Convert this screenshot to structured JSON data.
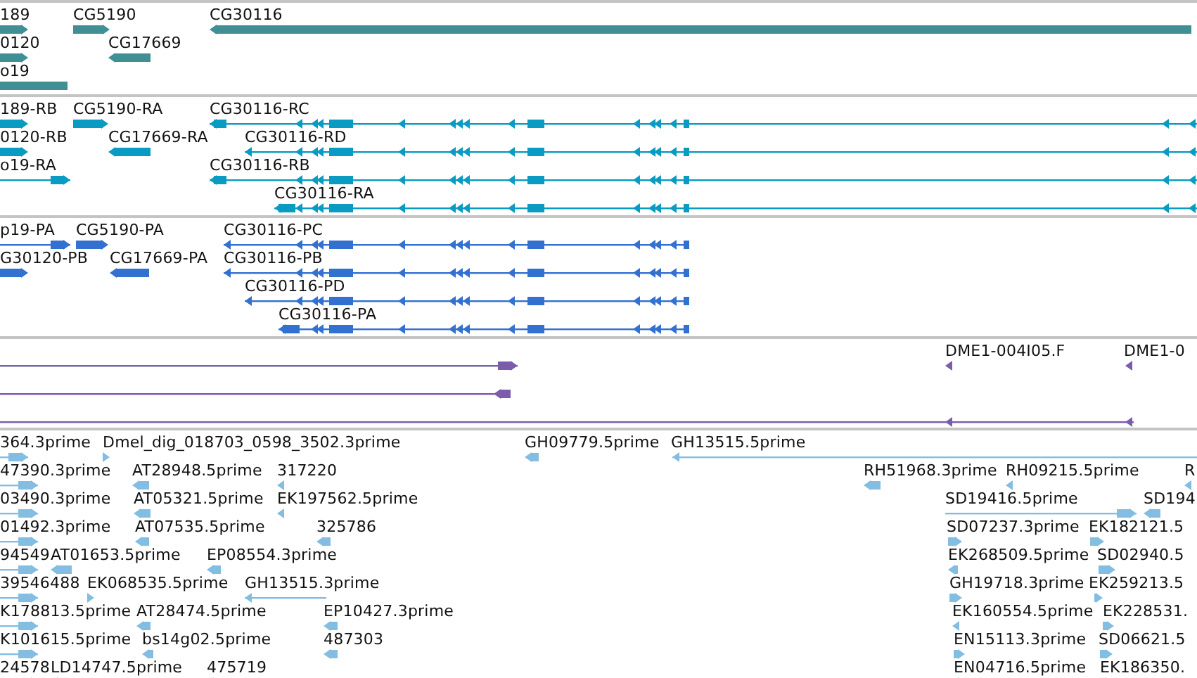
{
  "tracks": [
    {
      "kind": "gene",
      "features": [
        "189",
        "CG5190",
        "CG30116",
        "0120",
        "CG17669",
        "o19"
      ]
    },
    {
      "kind": "mrna",
      "features": [
        "189-RB",
        "CG5190-RA",
        "CG30116-RC",
        "0120-RB",
        "CG17669-RA",
        "CG30116-RD",
        "o19-RA",
        "CG30116-RB",
        "CG30116-RA"
      ]
    },
    {
      "kind": "cds",
      "features": [
        "p19-PA",
        "CG5190-PA",
        "CG30116-PC",
        "G30120-PB",
        "CG17669-PA",
        "CG30116-PB",
        "CG30116-PD",
        "CG30116-PA"
      ]
    },
    {
      "kind": "clone",
      "features": [
        "DME1-004I05.F",
        "DME1-0"
      ]
    },
    {
      "kind": "est",
      "features": [
        "364.3prime",
        "Dmel_dig_018703_0598_3502.3prime",
        "GH09779.5prime",
        "GH13515.5prime",
        "47390.3prime",
        "AT28948.5prime",
        "317220",
        "RH51968.3prime",
        "RH09215.5prime",
        "R",
        "03490.3prime",
        "AT05321.5prime",
        "EK197562.5prime",
        "SD19416.5prime",
        "SD194",
        "01492.3prime",
        "AT07535.5prime",
        "325786",
        "SD07237.3prime",
        "EK182121.5",
        "94549",
        "AT01653.5prime",
        "EP08554.3prime",
        "EK268509.5prime",
        "SD02940.5",
        "39546488",
        "EK068535.5prime",
        "GH13515.3prime",
        "GH19718.3prime",
        "EK259213.5",
        "K178813.5prime",
        "AT28474.5prime",
        "EP10427.3prime",
        "EK160554.5prime",
        "EK228531.",
        "K101615.5prime",
        "bs14g02.5prime",
        "487303",
        "EN15113.3prime",
        "SD06621.5",
        "24578",
        "LD14747.5prime",
        "475719",
        "EN04716.5prime",
        "EK186350."
      ]
    }
  ]
}
